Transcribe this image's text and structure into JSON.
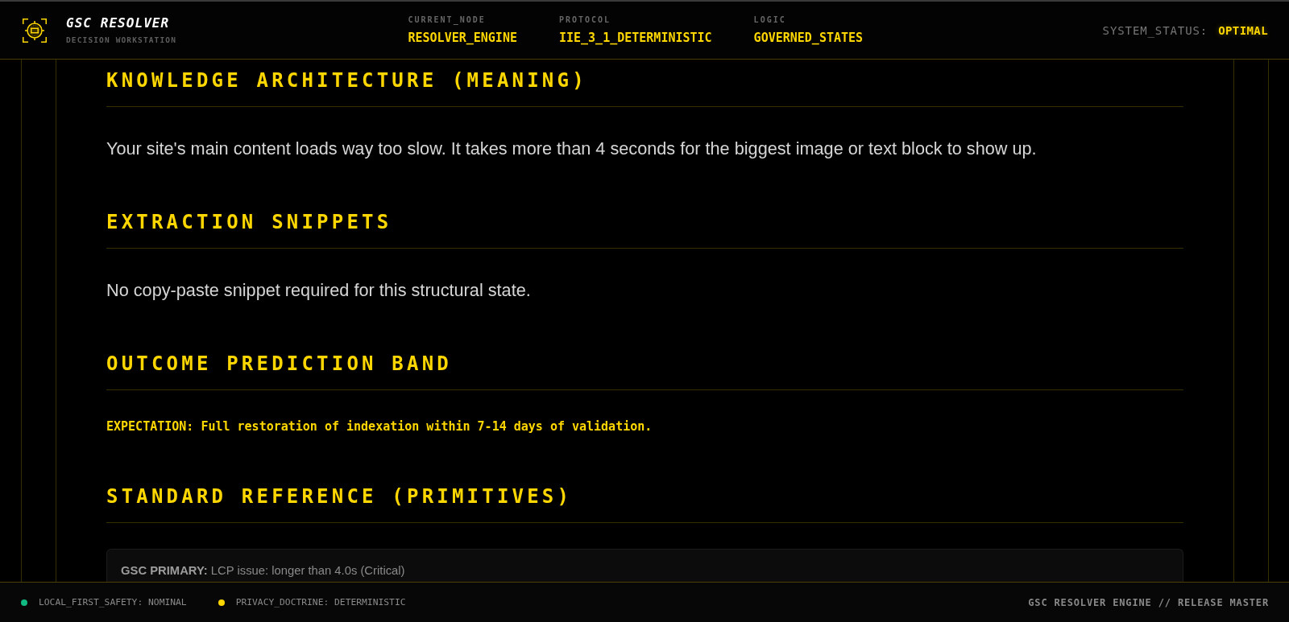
{
  "header": {
    "title": "GSC RESOLVER",
    "subtitle": "DECISION WORKSTATION",
    "meta": [
      {
        "label": "CURRENT_NODE",
        "value": "RESOLVER_ENGINE"
      },
      {
        "label": "PROTOCOL",
        "value": "IIE_3_1_DETERMINISTIC"
      },
      {
        "label": "LOGIC",
        "value": "GOVERNED_STATES"
      }
    ],
    "status": {
      "label": "SYSTEM_STATUS:",
      "value": "OPTIMAL"
    }
  },
  "sections": [
    {
      "kind": "paragraph",
      "heading": "KNOWLEDGE ARCHITECTURE (MEANING)",
      "text": "Your site's main content loads way too slow. It takes more than 4 seconds for the biggest image or text block to show up."
    },
    {
      "kind": "paragraph",
      "heading": "EXTRACTION SNIPPETS",
      "text": "No copy-paste snippet required for this structural state."
    },
    {
      "kind": "expectation",
      "heading": "OUTCOME PREDICTION BAND",
      "text": "EXPECTATION: Full restoration of indexation within 7-14 days of validation."
    },
    {
      "kind": "card",
      "heading": "STANDARD REFERENCE (PRIMITIVES)",
      "text": "**GSC PRIMARY:** LCP issue: longer than 4.0s (Critical)"
    }
  ],
  "footer": {
    "indicators": [
      {
        "label": "LOCAL_FIRST_SAFETY: NOMINAL",
        "color": "#10b981"
      },
      {
        "label": "PRIVACY_DOCTRINE: DETERMINISTIC",
        "color": "#ffd700"
      }
    ],
    "release": "GSC RESOLVER ENGINE // RELEASE MASTER"
  }
}
